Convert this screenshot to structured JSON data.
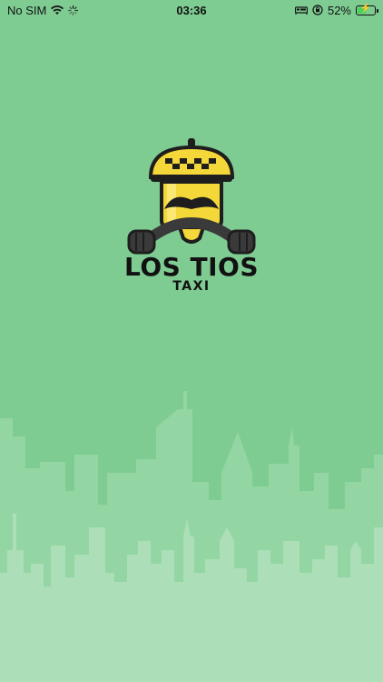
{
  "status_bar": {
    "carrier": "No SIM",
    "time": "03:36",
    "battery_percent": "52%",
    "battery_level": 0.52,
    "icons": [
      "wifi-icon",
      "loading-icon",
      "bed-icon",
      "orientation-lock-icon",
      "battery-icon"
    ]
  },
  "logo": {
    "title": "LOS TIOS",
    "subtitle": "TAXI"
  },
  "colors": {
    "background": "#7fcc93",
    "skyline_back": "#93d6a4",
    "skyline_front": "#acdfb7",
    "cap_yellow": "#f4d738",
    "dark": "#1e1e1e"
  }
}
